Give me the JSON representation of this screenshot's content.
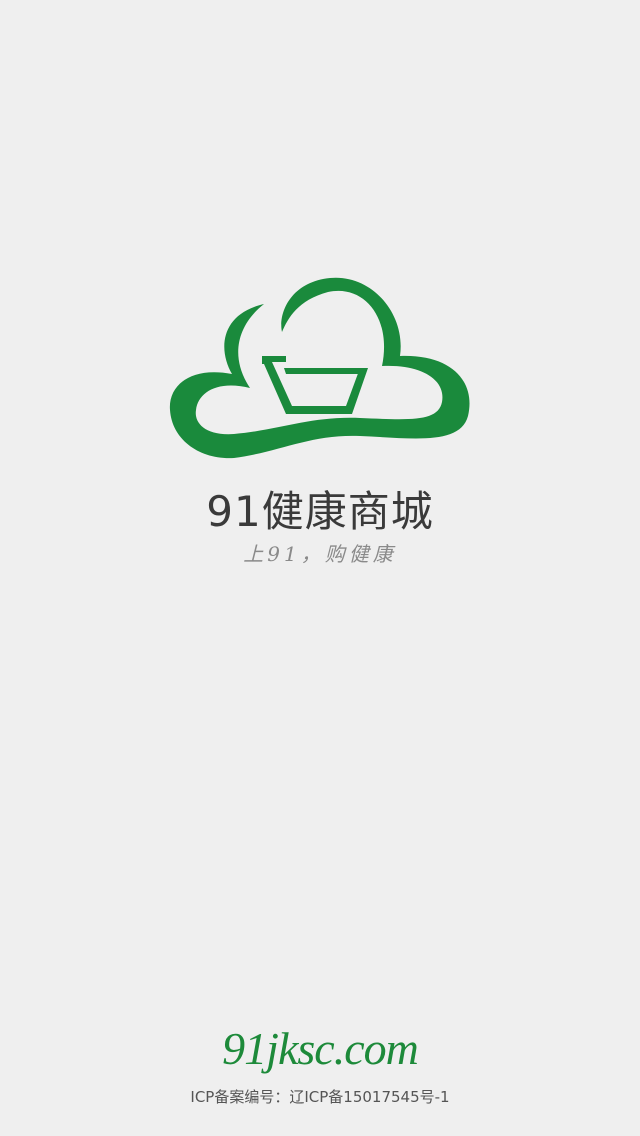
{
  "splash": {
    "app_name": "91健康商城",
    "slogan": "上91，购健康",
    "site_url": "91jksc.com",
    "icp_text": "ICP备案编号：辽ICP备15017545号-1"
  },
  "logo": {
    "icon": "cloud-cart-logo-icon",
    "color": "#1a8a3c"
  },
  "theme": {
    "background": "#efefef",
    "brand_green": "#1a8a3c",
    "title_color": "#3a3a3a",
    "slogan_color": "#8a8a8a"
  }
}
